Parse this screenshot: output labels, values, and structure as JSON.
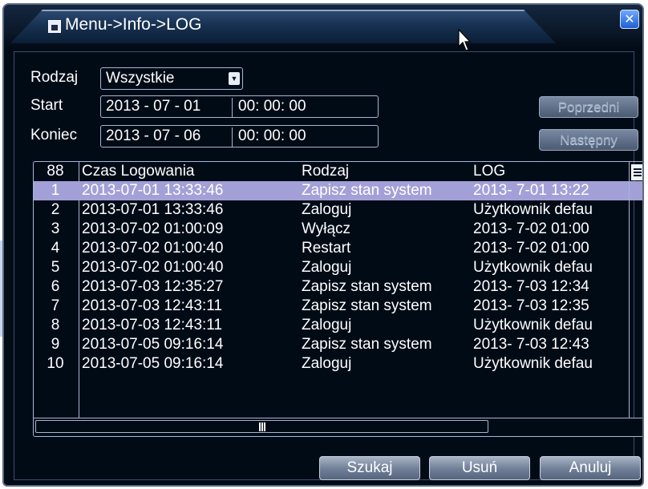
{
  "window": {
    "title": "Menu->Info->LOG",
    "close_symbol": "✕"
  },
  "filters": {
    "type_label": "Rodzaj",
    "type_value": "Wszystkie",
    "start_label": "Start",
    "start_date": "2013 - 07 - 01",
    "start_time": "00: 00: 00",
    "end_label": "Koniec",
    "end_date": "2013 - 07 - 06",
    "end_time": "00: 00: 00"
  },
  "nav": {
    "prev_label": "Poprzedni",
    "next_label": "Następny"
  },
  "table": {
    "headers": [
      "88",
      "Czas Logowania",
      "Rodzaj",
      "LOG"
    ],
    "rows": [
      [
        "1",
        "2013-07-01 13:33:46",
        "Zapisz stan system",
        "2013- 7-01 13:22"
      ],
      [
        "2",
        "2013-07-01 13:33:46",
        "Zaloguj",
        "Użytkownik defau"
      ],
      [
        "3",
        "2013-07-02 01:00:09",
        "Wyłącz",
        "2013- 7-02 01:00"
      ],
      [
        "4",
        "2013-07-02 01:00:40",
        "Restart",
        "2013- 7-02 01:00"
      ],
      [
        "5",
        "2013-07-02 01:00:40",
        "Zaloguj",
        "Użytkownik defau"
      ],
      [
        "6",
        "2013-07-03 12:35:27",
        "Zapisz stan system",
        "2013- 7-03 12:34"
      ],
      [
        "7",
        "2013-07-03 12:43:11",
        "Zapisz stan system",
        "2013- 7-03 12:35"
      ],
      [
        "8",
        "2013-07-03 12:43:11",
        "Zaloguj",
        "Użytkownik defau"
      ],
      [
        "9",
        "2013-07-05 09:16:14",
        "Zapisz stan system",
        "2013- 7-03 12:43"
      ],
      [
        "10",
        "2013-07-05 09:16:14",
        "Zaloguj",
        "Użytkownik defau"
      ]
    ],
    "selected_row": 0
  },
  "actions": {
    "search_label": "Szukaj",
    "delete_label": "Usuń",
    "cancel_label": "Anuluj"
  },
  "colors": {
    "background": "#010b16",
    "selected_row": "#a3a0d8",
    "border": "#a6b6d4"
  },
  "icons": {
    "title": "window-icon",
    "close": "close-icon",
    "dropdown": "chevron-down-icon",
    "list": "list-menu-icon",
    "cursor": "mouse-pointer-icon"
  }
}
